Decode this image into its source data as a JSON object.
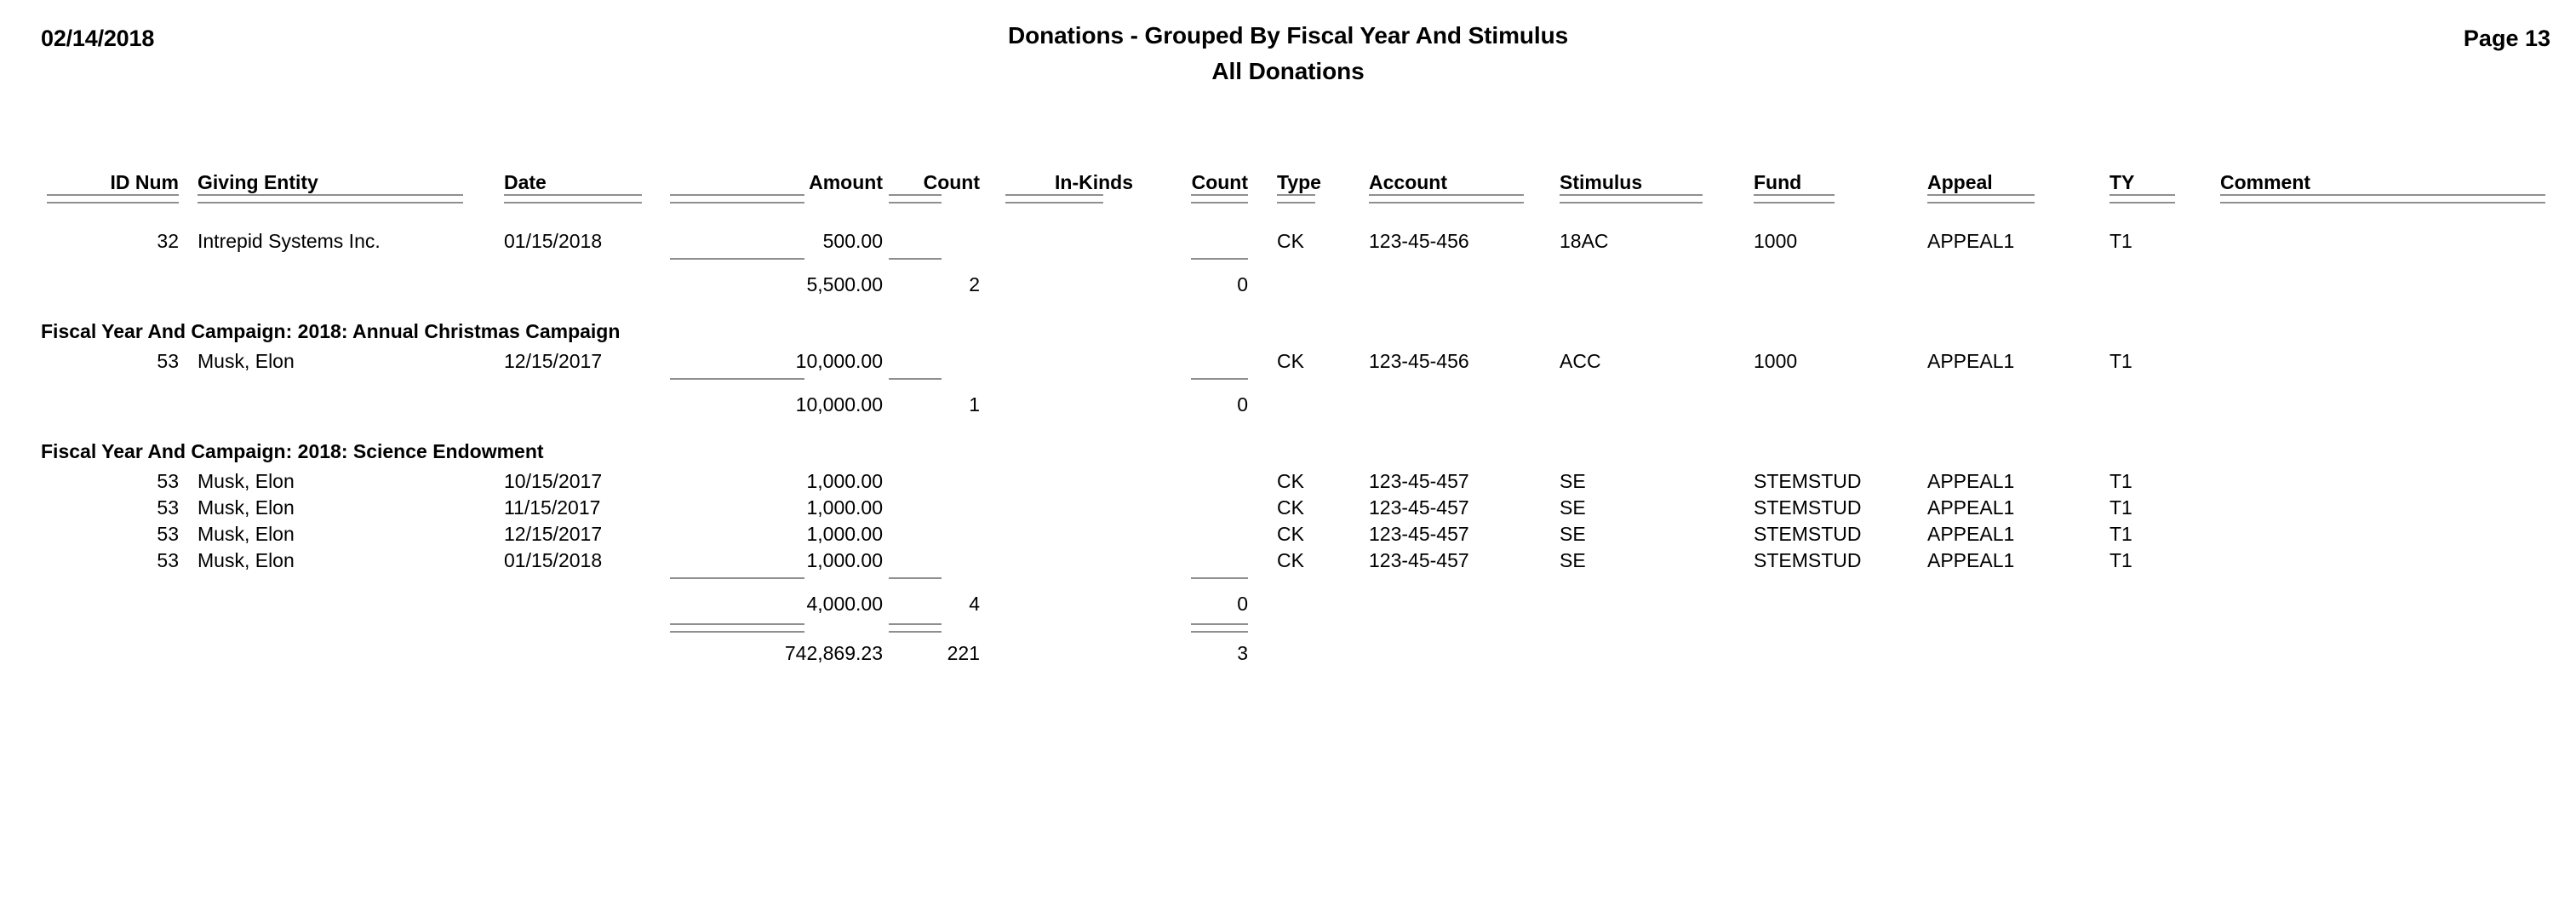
{
  "header": {
    "date": "02/14/2018",
    "title": "Donations - Grouped By Fiscal Year And Stimulus",
    "subtitle": "All Donations",
    "page_label": "Page 13"
  },
  "columns": {
    "id_num": "ID Num",
    "giving_entity": "Giving Entity",
    "date": "Date",
    "amount": "Amount",
    "count": "Count",
    "in_kinds": "In-Kinds",
    "count2": "Count",
    "type": "Type",
    "account": "Account",
    "stimulus": "Stimulus",
    "fund": "Fund",
    "appeal": "Appeal",
    "ty": "TY",
    "comment": "Comment"
  },
  "groups": [
    {
      "title": "",
      "rows": [
        {
          "id_num": "32",
          "giving_entity": "Intrepid Systems Inc.",
          "date": "01/15/2018",
          "amount": "500.00",
          "count": "",
          "in_kinds": "",
          "count2": "",
          "type": "CK",
          "account": "123-45-456",
          "stimulus": "18AC",
          "fund": "1000",
          "appeal": "APPEAL1",
          "ty": "T1",
          "comment": ""
        }
      ],
      "subtotal": {
        "amount": "5,500.00",
        "count": "2",
        "in_kinds": "",
        "count2": "0"
      }
    },
    {
      "title": "Fiscal Year And Campaign: 2018: Annual Christmas Campaign",
      "rows": [
        {
          "id_num": "53",
          "giving_entity": "Musk, Elon",
          "date": "12/15/2017",
          "amount": "10,000.00",
          "count": "",
          "in_kinds": "",
          "count2": "",
          "type": "CK",
          "account": "123-45-456",
          "stimulus": "ACC",
          "fund": "1000",
          "appeal": "APPEAL1",
          "ty": "T1",
          "comment": ""
        }
      ],
      "subtotal": {
        "amount": "10,000.00",
        "count": "1",
        "in_kinds": "",
        "count2": "0"
      }
    },
    {
      "title": "Fiscal Year And Campaign: 2018: Science Endowment",
      "rows": [
        {
          "id_num": "53",
          "giving_entity": "Musk, Elon",
          "date": "10/15/2017",
          "amount": "1,000.00",
          "count": "",
          "in_kinds": "",
          "count2": "",
          "type": "CK",
          "account": "123-45-457",
          "stimulus": "SE",
          "fund": "STEMSTUD",
          "appeal": "APPEAL1",
          "ty": "T1",
          "comment": ""
        },
        {
          "id_num": "53",
          "giving_entity": "Musk, Elon",
          "date": "11/15/2017",
          "amount": "1,000.00",
          "count": "",
          "in_kinds": "",
          "count2": "",
          "type": "CK",
          "account": "123-45-457",
          "stimulus": "SE",
          "fund": "STEMSTUD",
          "appeal": "APPEAL1",
          "ty": "T1",
          "comment": ""
        },
        {
          "id_num": "53",
          "giving_entity": "Musk, Elon",
          "date": "12/15/2017",
          "amount": "1,000.00",
          "count": "",
          "in_kinds": "",
          "count2": "",
          "type": "CK",
          "account": "123-45-457",
          "stimulus": "SE",
          "fund": "STEMSTUD",
          "appeal": "APPEAL1",
          "ty": "T1",
          "comment": ""
        },
        {
          "id_num": "53",
          "giving_entity": "Musk, Elon",
          "date": "01/15/2018",
          "amount": "1,000.00",
          "count": "",
          "in_kinds": "",
          "count2": "",
          "type": "CK",
          "account": "123-45-457",
          "stimulus": "SE",
          "fund": "STEMSTUD",
          "appeal": "APPEAL1",
          "ty": "T1",
          "comment": ""
        }
      ],
      "subtotal": {
        "amount": "4,000.00",
        "count": "4",
        "in_kinds": "",
        "count2": "0"
      }
    }
  ],
  "grand_total": {
    "amount": "742,869.23",
    "count": "221",
    "in_kinds": "",
    "count2": "3"
  }
}
